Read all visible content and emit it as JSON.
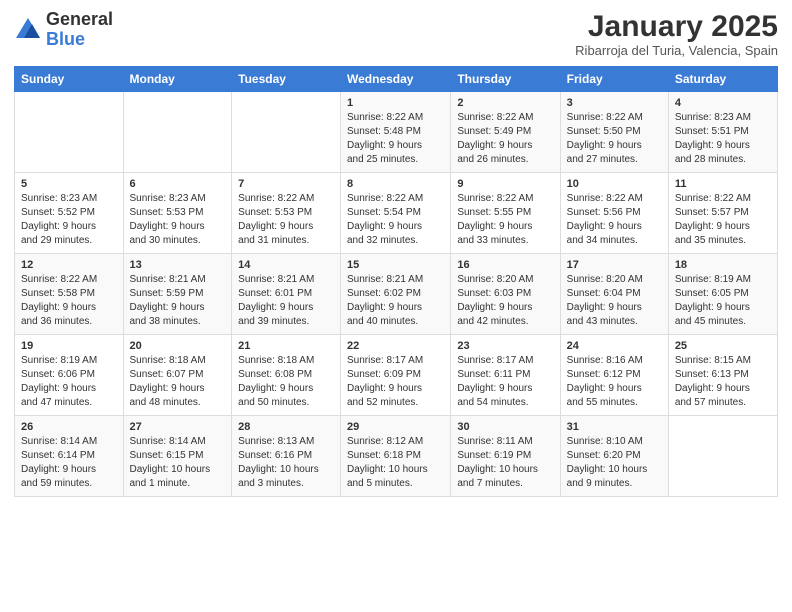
{
  "header": {
    "logo_general": "General",
    "logo_blue": "Blue",
    "month": "January 2025",
    "location": "Ribarroja del Turia, Valencia, Spain"
  },
  "weekdays": [
    "Sunday",
    "Monday",
    "Tuesday",
    "Wednesday",
    "Thursday",
    "Friday",
    "Saturday"
  ],
  "weeks": [
    [
      {
        "day": "",
        "info": ""
      },
      {
        "day": "",
        "info": ""
      },
      {
        "day": "",
        "info": ""
      },
      {
        "day": "1",
        "info": "Sunrise: 8:22 AM\nSunset: 5:48 PM\nDaylight: 9 hours\nand 25 minutes."
      },
      {
        "day": "2",
        "info": "Sunrise: 8:22 AM\nSunset: 5:49 PM\nDaylight: 9 hours\nand 26 minutes."
      },
      {
        "day": "3",
        "info": "Sunrise: 8:22 AM\nSunset: 5:50 PM\nDaylight: 9 hours\nand 27 minutes."
      },
      {
        "day": "4",
        "info": "Sunrise: 8:23 AM\nSunset: 5:51 PM\nDaylight: 9 hours\nand 28 minutes."
      }
    ],
    [
      {
        "day": "5",
        "info": "Sunrise: 8:23 AM\nSunset: 5:52 PM\nDaylight: 9 hours\nand 29 minutes."
      },
      {
        "day": "6",
        "info": "Sunrise: 8:23 AM\nSunset: 5:53 PM\nDaylight: 9 hours\nand 30 minutes."
      },
      {
        "day": "7",
        "info": "Sunrise: 8:22 AM\nSunset: 5:53 PM\nDaylight: 9 hours\nand 31 minutes."
      },
      {
        "day": "8",
        "info": "Sunrise: 8:22 AM\nSunset: 5:54 PM\nDaylight: 9 hours\nand 32 minutes."
      },
      {
        "day": "9",
        "info": "Sunrise: 8:22 AM\nSunset: 5:55 PM\nDaylight: 9 hours\nand 33 minutes."
      },
      {
        "day": "10",
        "info": "Sunrise: 8:22 AM\nSunset: 5:56 PM\nDaylight: 9 hours\nand 34 minutes."
      },
      {
        "day": "11",
        "info": "Sunrise: 8:22 AM\nSunset: 5:57 PM\nDaylight: 9 hours\nand 35 minutes."
      }
    ],
    [
      {
        "day": "12",
        "info": "Sunrise: 8:22 AM\nSunset: 5:58 PM\nDaylight: 9 hours\nand 36 minutes."
      },
      {
        "day": "13",
        "info": "Sunrise: 8:21 AM\nSunset: 5:59 PM\nDaylight: 9 hours\nand 38 minutes."
      },
      {
        "day": "14",
        "info": "Sunrise: 8:21 AM\nSunset: 6:01 PM\nDaylight: 9 hours\nand 39 minutes."
      },
      {
        "day": "15",
        "info": "Sunrise: 8:21 AM\nSunset: 6:02 PM\nDaylight: 9 hours\nand 40 minutes."
      },
      {
        "day": "16",
        "info": "Sunrise: 8:20 AM\nSunset: 6:03 PM\nDaylight: 9 hours\nand 42 minutes."
      },
      {
        "day": "17",
        "info": "Sunrise: 8:20 AM\nSunset: 6:04 PM\nDaylight: 9 hours\nand 43 minutes."
      },
      {
        "day": "18",
        "info": "Sunrise: 8:19 AM\nSunset: 6:05 PM\nDaylight: 9 hours\nand 45 minutes."
      }
    ],
    [
      {
        "day": "19",
        "info": "Sunrise: 8:19 AM\nSunset: 6:06 PM\nDaylight: 9 hours\nand 47 minutes."
      },
      {
        "day": "20",
        "info": "Sunrise: 8:18 AM\nSunset: 6:07 PM\nDaylight: 9 hours\nand 48 minutes."
      },
      {
        "day": "21",
        "info": "Sunrise: 8:18 AM\nSunset: 6:08 PM\nDaylight: 9 hours\nand 50 minutes."
      },
      {
        "day": "22",
        "info": "Sunrise: 8:17 AM\nSunset: 6:09 PM\nDaylight: 9 hours\nand 52 minutes."
      },
      {
        "day": "23",
        "info": "Sunrise: 8:17 AM\nSunset: 6:11 PM\nDaylight: 9 hours\nand 54 minutes."
      },
      {
        "day": "24",
        "info": "Sunrise: 8:16 AM\nSunset: 6:12 PM\nDaylight: 9 hours\nand 55 minutes."
      },
      {
        "day": "25",
        "info": "Sunrise: 8:15 AM\nSunset: 6:13 PM\nDaylight: 9 hours\nand 57 minutes."
      }
    ],
    [
      {
        "day": "26",
        "info": "Sunrise: 8:14 AM\nSunset: 6:14 PM\nDaylight: 9 hours\nand 59 minutes."
      },
      {
        "day": "27",
        "info": "Sunrise: 8:14 AM\nSunset: 6:15 PM\nDaylight: 10 hours\nand 1 minute."
      },
      {
        "day": "28",
        "info": "Sunrise: 8:13 AM\nSunset: 6:16 PM\nDaylight: 10 hours\nand 3 minutes."
      },
      {
        "day": "29",
        "info": "Sunrise: 8:12 AM\nSunset: 6:18 PM\nDaylight: 10 hours\nand 5 minutes."
      },
      {
        "day": "30",
        "info": "Sunrise: 8:11 AM\nSunset: 6:19 PM\nDaylight: 10 hours\nand 7 minutes."
      },
      {
        "day": "31",
        "info": "Sunrise: 8:10 AM\nSunset: 6:20 PM\nDaylight: 10 hours\nand 9 minutes."
      },
      {
        "day": "",
        "info": ""
      }
    ]
  ]
}
